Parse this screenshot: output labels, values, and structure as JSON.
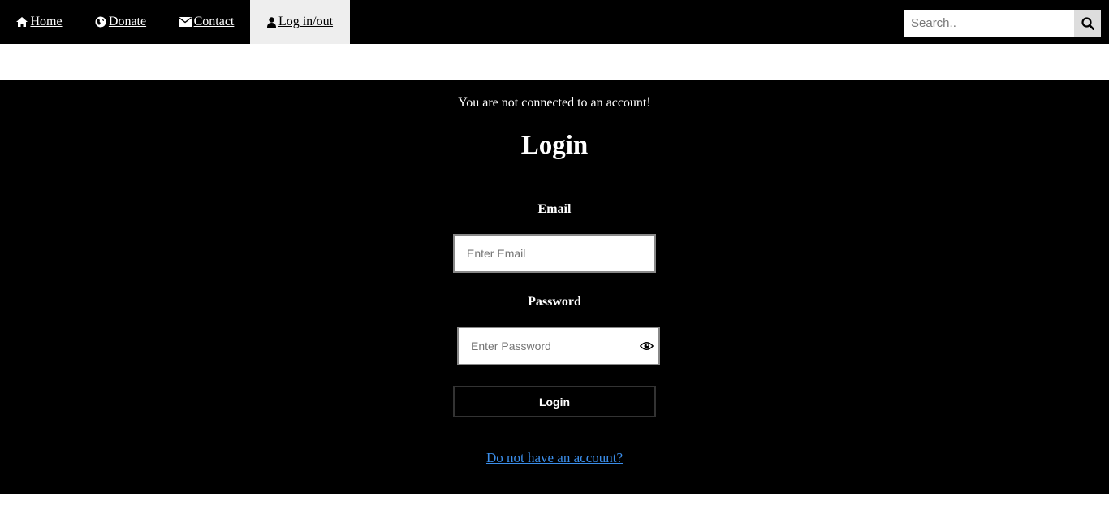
{
  "nav": {
    "items": [
      {
        "label": "Home",
        "icon": "home-icon"
      },
      {
        "label": "Donate",
        "icon": "globe-icon"
      },
      {
        "label": "Contact",
        "icon": "envelope-icon"
      },
      {
        "label": "Log in/out",
        "icon": "user-icon",
        "active": true
      }
    ],
    "search": {
      "placeholder": "Search..",
      "icon": "search-icon"
    }
  },
  "login": {
    "status": "You are not connected to an account!",
    "title": "Login",
    "email": {
      "label": "Email",
      "placeholder": "Enter Email",
      "value": ""
    },
    "password": {
      "label": "Password",
      "placeholder": "Enter Password",
      "value": "",
      "toggle_icon": "eye-icon"
    },
    "submit_label": "Login",
    "signup_link": "Do not have an account?"
  },
  "colors": {
    "navbar_bg": "#000000",
    "active_tab_bg": "#eeeeee",
    "main_bg": "#000000",
    "link": "#3b8eea"
  }
}
